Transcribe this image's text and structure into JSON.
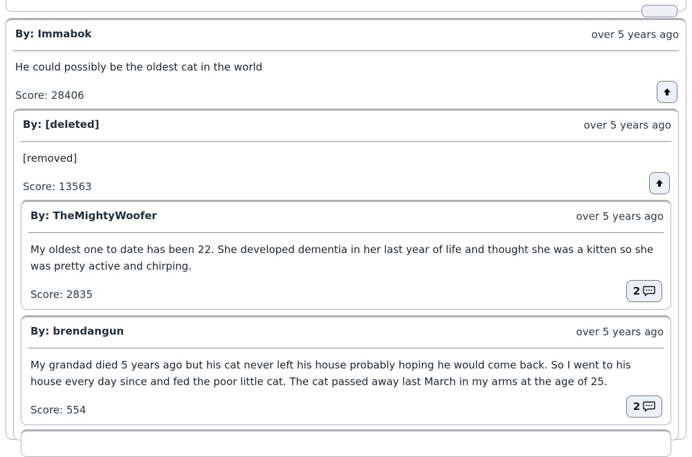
{
  "comments": [
    {
      "author": "By: Immabok",
      "time": "over 5 years ago",
      "text": "He could possibly be the oldest cat in the world",
      "score": "Score: 28406",
      "action": "upvote-icon"
    },
    {
      "author": "By: [deleted]",
      "time": "over 5 years ago",
      "text": "[removed]",
      "score": "Score: 13563",
      "action": "upvote-icon"
    },
    {
      "author": "By: TheMightyWoofer",
      "time": "over 5 years ago",
      "text": "My oldest one to date has been 22. She developed dementia in her last year of life and thought she was a kitten so she was pretty active and chirping.",
      "score": "Score: 2835",
      "reply_count": "2",
      "action": "comment-icon"
    },
    {
      "author": "By: brendangun",
      "time": "over 5 years ago",
      "text": "My grandad died 5 years ago but his cat never left his house probably hoping he would come back. So I went to his house every day since and fed the poor little cat. The cat passed away last March in my arms at the age of 25.",
      "score": "Score: 554",
      "reply_count": "2",
      "action": "comment-icon"
    }
  ]
}
